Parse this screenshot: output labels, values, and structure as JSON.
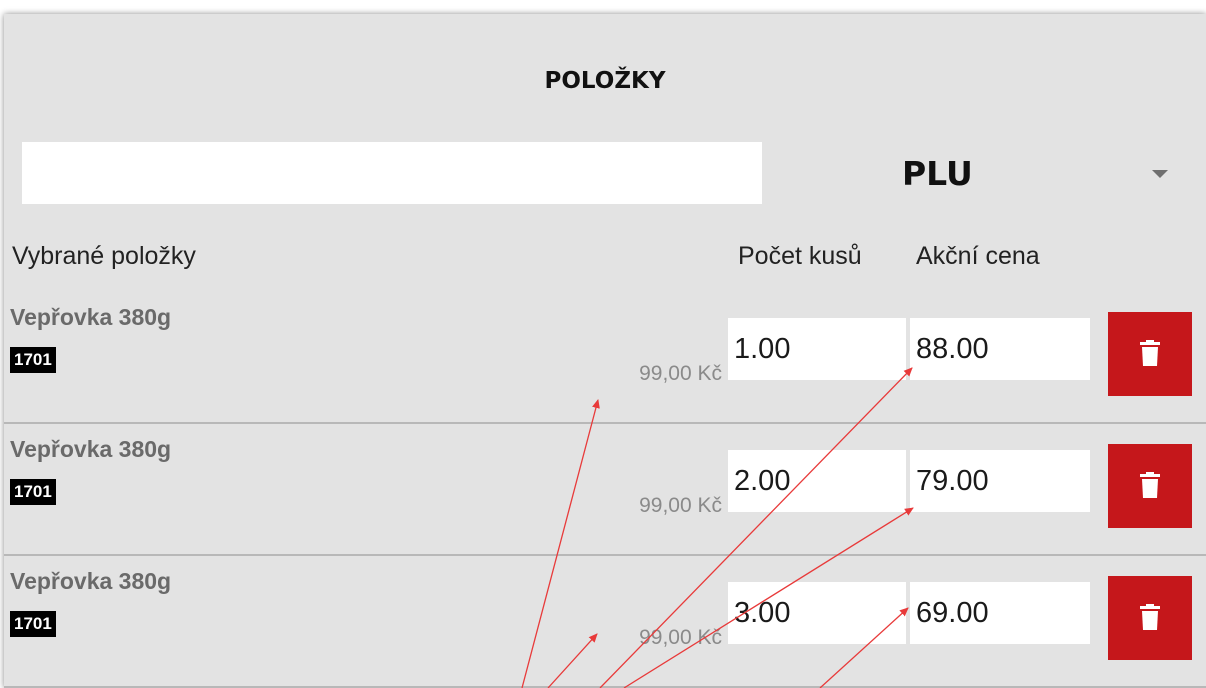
{
  "header": {
    "title": "POLOŽKY"
  },
  "search": {
    "value": "",
    "placeholder": ""
  },
  "selector": {
    "value": "PLU",
    "icon": "chevron-down-icon"
  },
  "columns": {
    "items": "Vybrané položky",
    "qty": "Počet kusů",
    "price": "Akční cena"
  },
  "rows": [
    {
      "name": "Vepřovka 380g",
      "code": "1701",
      "original_price": "99,00 Kč",
      "qty": "1.00",
      "price": "88.00"
    },
    {
      "name": "Vepřovka 380g",
      "code": "1701",
      "original_price": "99,00 Kč",
      "qty": "2.00",
      "price": "79.00"
    },
    {
      "name": "Vepřovka 380g",
      "code": "1701",
      "original_price": "99,00 Kč",
      "qty": "3.00",
      "price": "69.00"
    }
  ],
  "colors": {
    "panel": "#e3e3e3",
    "delete_button": "#c5171b",
    "annotation_arrow": "#e83a3a"
  }
}
